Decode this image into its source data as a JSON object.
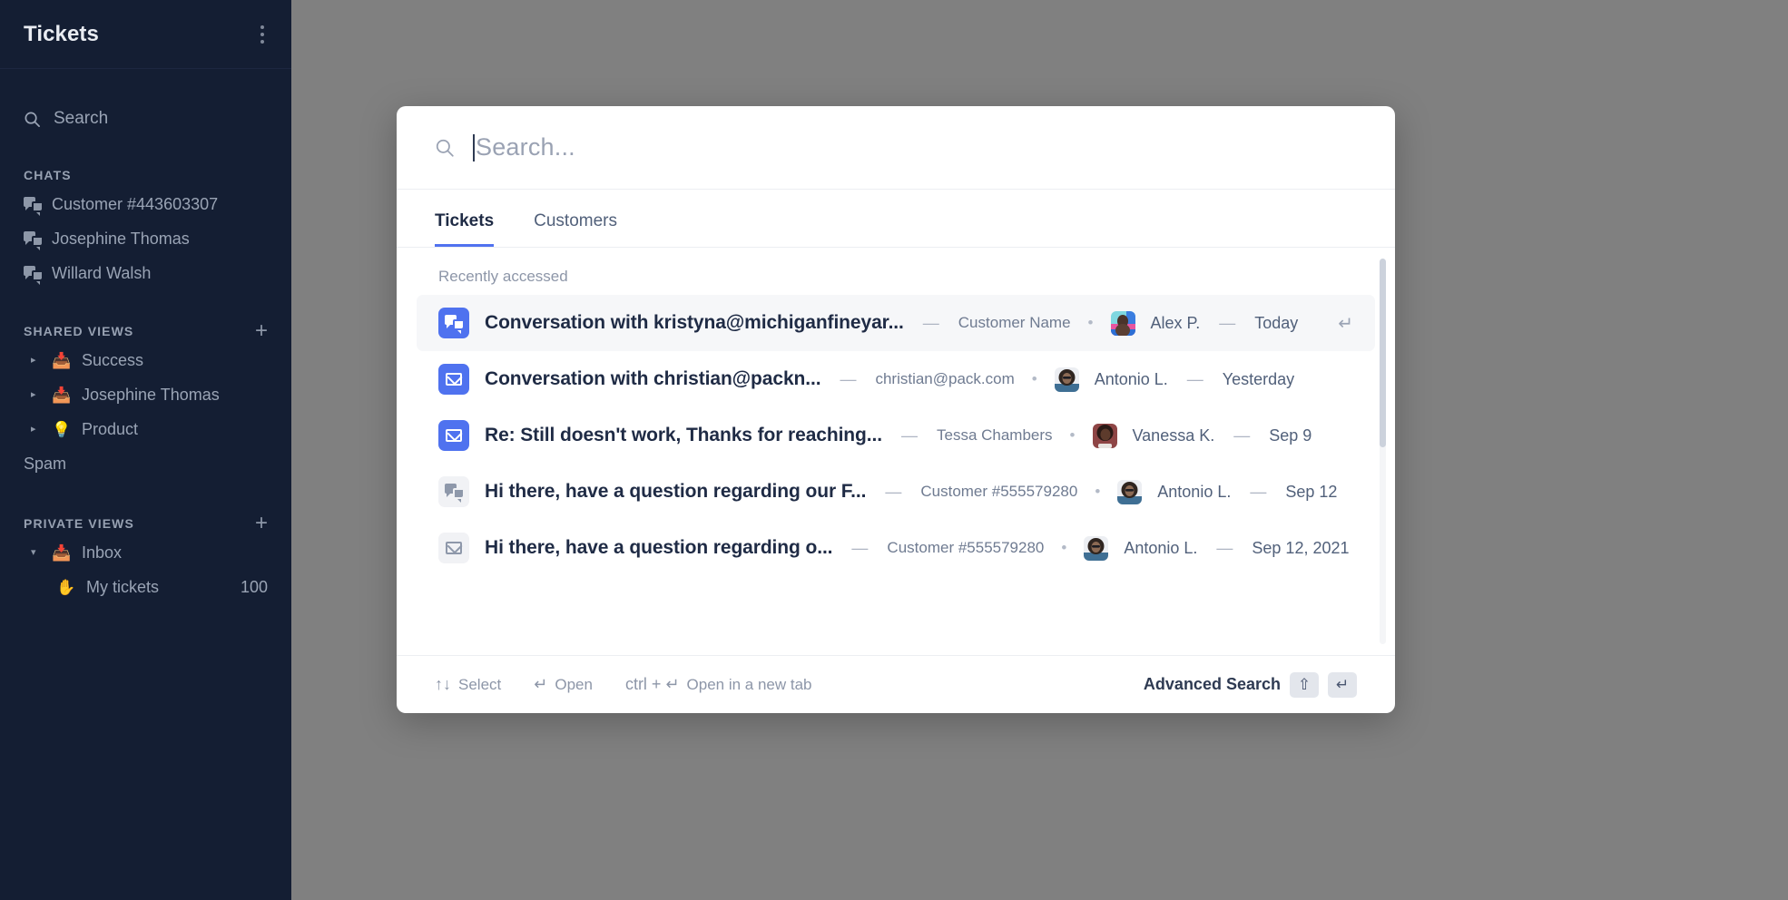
{
  "sidebar": {
    "title": "Tickets",
    "menu_icon": "kebab-menu-icon",
    "search": {
      "label": "Search",
      "icon": "search-icon"
    },
    "chats": {
      "caption": "CHATS",
      "items": [
        {
          "label": "Customer #443603307",
          "icon": "chat-icon"
        },
        {
          "label": "Josephine Thomas",
          "icon": "chat-icon"
        },
        {
          "label": "Willard Walsh",
          "icon": "chat-icon"
        }
      ]
    },
    "shared_views": {
      "caption": "SHARED VIEWS",
      "add_label": "+",
      "items": [
        {
          "label": "Success",
          "emoji": "📥",
          "caret": "▸"
        },
        {
          "label": "Josephine Thomas",
          "emoji": "📥",
          "caret": "▸"
        },
        {
          "label": "Product",
          "emoji": "💡",
          "caret": "▸"
        }
      ],
      "spam_label": "Spam"
    },
    "private_views": {
      "caption": "PRIVATE VIEWS",
      "add_label": "+",
      "items": [
        {
          "label": "Inbox",
          "emoji": "📥",
          "caret": "▾",
          "count": ""
        },
        {
          "label": "My tickets",
          "emoji": "✋",
          "caret": "",
          "count": "100"
        }
      ]
    }
  },
  "dialog": {
    "search": {
      "value": "",
      "placeholder": "Search...",
      "icon": "search-icon"
    },
    "tabs": [
      {
        "label": "Tickets",
        "active": true
      },
      {
        "label": "Customers",
        "active": false
      }
    ],
    "section_label": "Recently accessed",
    "results": [
      {
        "icon": "chat-icon",
        "icon_style": "chat-blue",
        "title": "Conversation with kristyna@michiganfineyar...",
        "separator": "—",
        "meta": "Customer Name",
        "dot": "•",
        "avatar": "alex-p-avatar",
        "person": "Alex P.",
        "person_separator": "—",
        "date": "Today",
        "selected": true,
        "enter_hint": "↵"
      },
      {
        "icon": "mail-icon",
        "icon_style": "mail-blue",
        "title": "Conversation with christian@packn...",
        "separator": "—",
        "meta": "christian@pack.com",
        "dot": "•",
        "avatar": "antonio-l-avatar",
        "person": "Antonio L.",
        "person_separator": "—",
        "date": "Yesterday",
        "selected": false,
        "enter_hint": ""
      },
      {
        "icon": "mail-icon",
        "icon_style": "mail-blue",
        "title": "Re: Still doesn't work, Thanks for reaching...",
        "separator": "—",
        "meta": "Tessa Chambers",
        "dot": "•",
        "avatar": "vanessa-k-avatar",
        "person": "Vanessa K.",
        "person_separator": "—",
        "date": "Sep 9",
        "selected": false,
        "enter_hint": ""
      },
      {
        "icon": "chat-icon",
        "icon_style": "chat-gray",
        "title": "Hi there, have a question regarding our F...",
        "separator": "—",
        "meta": "Customer #555579280",
        "dot": "•",
        "avatar": "antonio-l-avatar",
        "person": "Antonio L.",
        "person_separator": "—",
        "date": "Sep 12",
        "selected": false,
        "enter_hint": ""
      },
      {
        "icon": "mail-icon",
        "icon_style": "mail-gray",
        "title": "Hi there, have a question regarding o...",
        "separator": "—",
        "meta": "Customer #555579280",
        "dot": "•",
        "avatar": "antonio-l-avatar",
        "person": "Antonio L.",
        "person_separator": "—",
        "date": "Sep 12, 2021",
        "selected": false,
        "enter_hint": ""
      }
    ],
    "footer": {
      "hints": [
        {
          "sym": "↑↓",
          "label": "Select"
        },
        {
          "sym": "↵",
          "label": "Open"
        },
        {
          "sym": "ctrl + ↵",
          "label": "Open in a new tab"
        }
      ],
      "advanced_search": "Advanced Search",
      "keys": [
        {
          "glyph": "⇧",
          "name": "shift-key"
        },
        {
          "glyph": "↵",
          "name": "enter-key"
        }
      ]
    }
  },
  "colors": {
    "sidebar_bg": "#141e33",
    "accent": "#4f72ef",
    "tab_underline": "#5172ef",
    "overlay": "#808080",
    "selected_row": "#f6f7f9"
  }
}
